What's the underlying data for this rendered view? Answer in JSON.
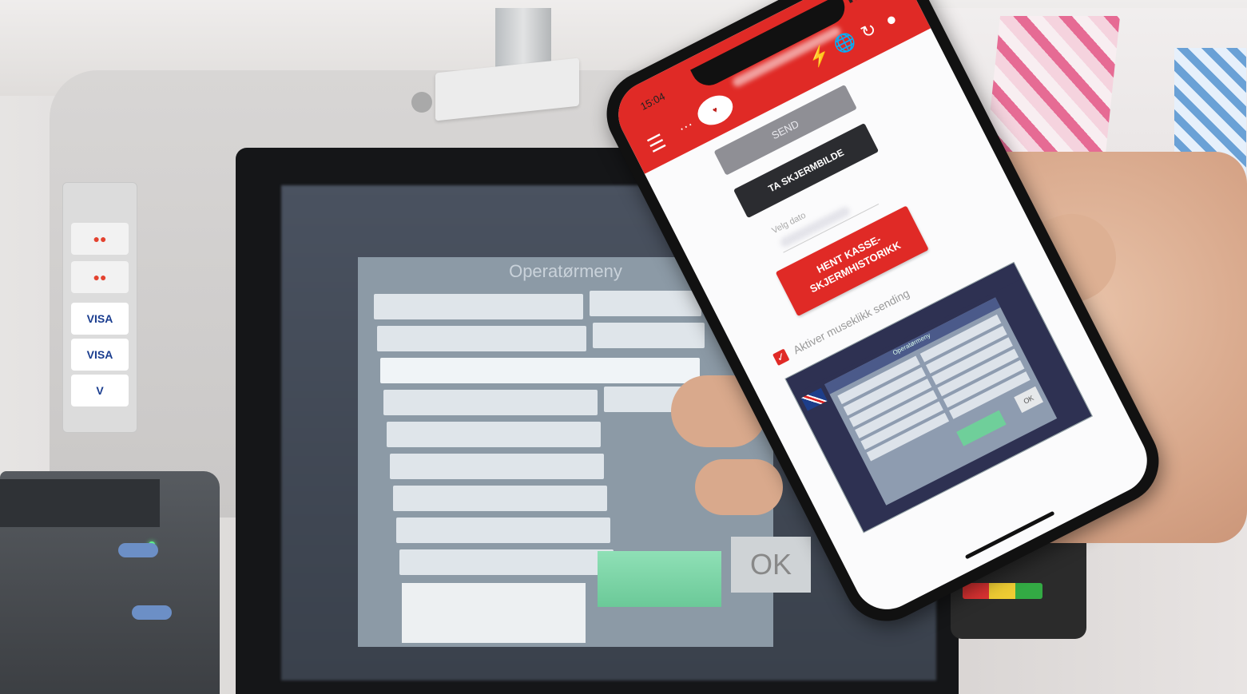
{
  "background": {
    "card_logos": [
      {
        "label": "●●",
        "color": "#e3422f"
      },
      {
        "label": "●●",
        "color": "#e3422f"
      },
      {
        "label": "VISA",
        "color": "#1a3d8f"
      },
      {
        "label": "VISA",
        "color": "#1a3d8f"
      },
      {
        "label": "V",
        "color": "#1a3d8f"
      }
    ],
    "pos_screen": {
      "title": "Operatørmeny",
      "ok_label": "OK"
    }
  },
  "phone": {
    "status_time": "15:04",
    "appbar": {
      "menu_icon": "hamburger-icon",
      "dots": "···",
      "icons": [
        "flash-icon",
        "globe-icon",
        "refresh-icon",
        "account-icon"
      ]
    },
    "send_label": "SEND",
    "screenshot_label": "TA SKJERMBILDE",
    "date_label": "Velg dato",
    "history_label": "HENT KASSE-\nSKJERMHISTORIKK",
    "checkbox_label": "Aktiver museklikk sending",
    "checkbox_checked": true,
    "preview": {
      "title": "Operatørmeny",
      "ok_label": "OK"
    },
    "accent_color": "#e02a26"
  }
}
